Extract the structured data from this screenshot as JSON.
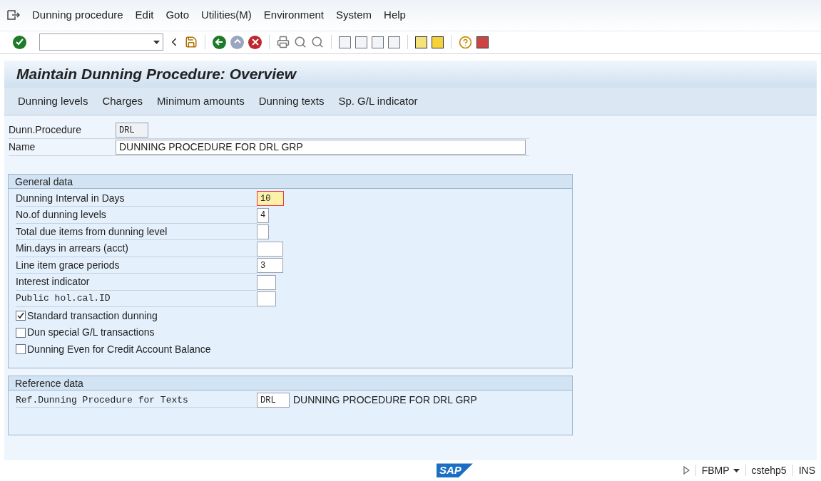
{
  "menu": [
    "Dunning procedure",
    "Edit",
    "Goto",
    "Utilities(M)",
    "Environment",
    "System",
    "Help"
  ],
  "title": "Maintain Dunning Procedure: Overview",
  "app_toolbar": [
    "Dunning levels",
    "Charges",
    "Minimum amounts",
    "Dunning texts",
    "Sp. G/L indicator"
  ],
  "header_fields": [
    {
      "label": "Dunn.Procedure",
      "value": "DRL"
    },
    {
      "label": "Name",
      "value": "DUNNING PROCEDURE FOR DRL GRP"
    }
  ],
  "general_data": {
    "title": "General data",
    "rows": [
      {
        "kind": "input",
        "label": "Dunning Interval in Days",
        "value": "10",
        "focused": true,
        "mono_label": false
      },
      {
        "kind": "input",
        "label": "No.of dunning levels",
        "value": "4",
        "focused": false,
        "mono_label": false
      },
      {
        "kind": "input",
        "label": "Total due items from dunning level",
        "value": "",
        "focused": false,
        "mono_label": false
      },
      {
        "kind": "input",
        "label": "Min.days in arrears (acct)",
        "value": "",
        "focused": false,
        "mono_label": false
      },
      {
        "kind": "input",
        "label": "Line item grace periods",
        "value": "3",
        "focused": false,
        "mono_label": false
      },
      {
        "kind": "input",
        "label": "Interest indicator",
        "value": "",
        "focused": false,
        "mono_label": false
      },
      {
        "kind": "input",
        "label": "Public hol.cal.ID",
        "value": "",
        "focused": false,
        "mono_label": true
      },
      {
        "kind": "checkbox",
        "label": "Standard transaction dunning",
        "checked": true
      },
      {
        "kind": "checkbox",
        "label": "Dun special G/L transactions",
        "checked": false
      },
      {
        "kind": "checkbox",
        "label": "Dunning Even for Credit Account Balance",
        "checked": false
      }
    ]
  },
  "reference_data": {
    "title": "Reference data",
    "label": "Ref.Dunning Procedure for Texts",
    "value": "DRL",
    "description": "DUNNING PROCEDURE FOR DRL GRP"
  },
  "status_bar": {
    "logo": "SAP",
    "transaction": "FBMP",
    "server": "cstehp5",
    "mode": "INS"
  }
}
